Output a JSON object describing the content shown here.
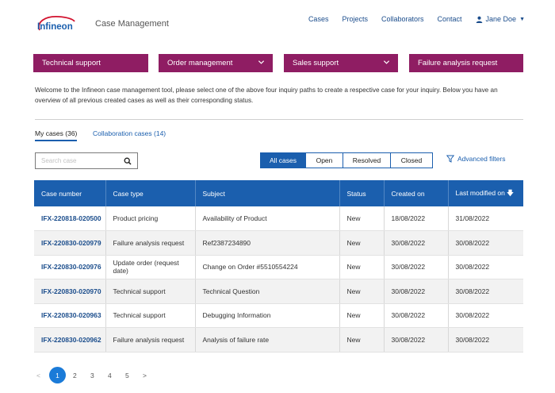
{
  "header": {
    "logo_text": "Infineon",
    "app_title": "Case Management",
    "nav": [
      "Cases",
      "Projects",
      "Collaborators",
      "Contact"
    ],
    "user_name": "Jane Doe"
  },
  "inquiry_paths": [
    {
      "label": "Technical support",
      "has_dropdown": false
    },
    {
      "label": "Order management",
      "has_dropdown": true
    },
    {
      "label": "Sales support",
      "has_dropdown": true
    },
    {
      "label": "Failure analysis request",
      "has_dropdown": false
    }
  ],
  "intro_text": "Welcome to the Infineon case management tool, please select one of the above four inquiry paths to create a respective case for your inquiry. Below you have an overview of all previous created cases as well as their corresponding status.",
  "case_tabs": {
    "my_cases": "My cases (36)",
    "collaboration_cases": "Collaboration cases (14)"
  },
  "search": {
    "placeholder": "Search case",
    "value": ""
  },
  "status_filter": {
    "options": [
      "All cases",
      "Open",
      "Resolved",
      "Closed"
    ],
    "selected": "All cases"
  },
  "advanced_filters_label": "Advanced filters",
  "table": {
    "columns": [
      "Case number",
      "Case type",
      "Subject",
      "Status",
      "Created on",
      "Last modified on"
    ],
    "sorted_column": "Last modified on",
    "rows": [
      [
        "IFX-220818-020500",
        "Product pricing",
        "Availability of Product",
        "New",
        "18/08/2022",
        "31/08/2022"
      ],
      [
        "IFX-220830-020979",
        "Failure analysis request",
        "Ref2387234890",
        "New",
        "30/08/2022",
        "30/08/2022"
      ],
      [
        "IFX-220830-020976",
        "Update order (request date)",
        "Change on Order #5510554224",
        "New",
        "30/08/2022",
        "30/08/2022"
      ],
      [
        "IFX-220830-020970",
        "Technical support",
        "Technical Question",
        "New",
        "30/08/2022",
        "30/08/2022"
      ],
      [
        "IFX-220830-020963",
        "Technical support",
        "Debugging Information",
        "New",
        "30/08/2022",
        "30/08/2022"
      ],
      [
        "IFX-220830-020962",
        "Failure analysis request",
        "Analysis of failure rate",
        "New",
        "30/08/2022",
        "30/08/2022"
      ]
    ]
  },
  "pagination": {
    "prev": "<",
    "pages": [
      "1",
      "2",
      "3",
      "4",
      "5"
    ],
    "current": "1",
    "next": ">"
  },
  "colors": {
    "brand_blue": "#1b5fae",
    "inquiry_purple": "#8f1d63",
    "link_blue": "#1b4d8c",
    "active_page": "#1b7bd8"
  }
}
